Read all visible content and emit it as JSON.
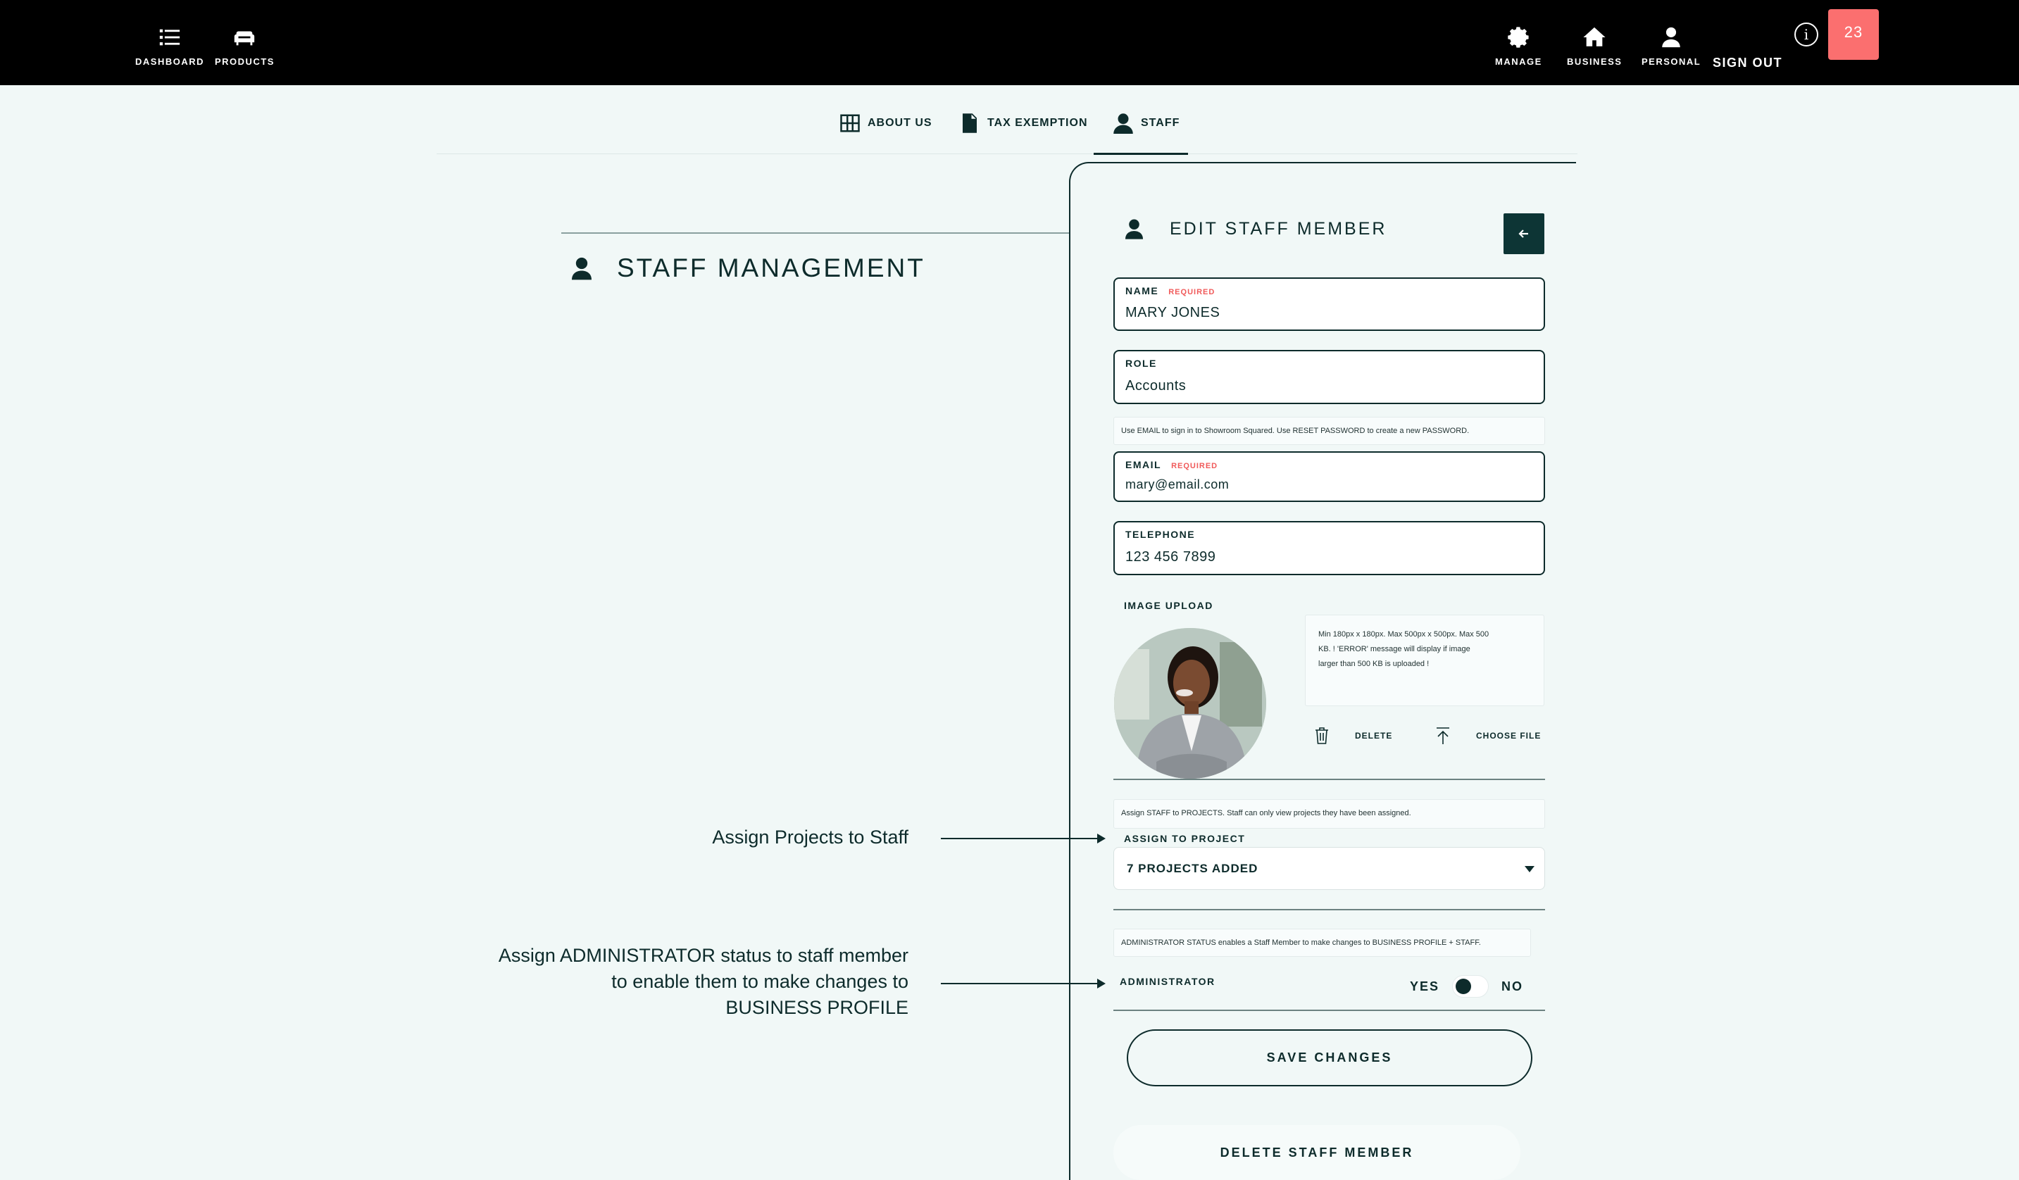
{
  "nav": {
    "dashboard": "DASHBOARD",
    "products": "PRODUCTS",
    "manage": "MANAGE",
    "business": "BUSINESS",
    "personal": "PERSONAL",
    "sign_out": "SIGN OUT",
    "info": "i",
    "badge_count": "23"
  },
  "tabs": [
    {
      "label": "ABOUT US",
      "icon": "group-icon"
    },
    {
      "label": "TAX EXEMPTION",
      "icon": "document-icon"
    },
    {
      "label": "STAFF",
      "icon": "person-icon",
      "active": true
    }
  ],
  "left": {
    "title": "STAFF MANAGEMENT",
    "annotation_projects": "Assign Projects to Staff",
    "annotation_admin_1": "Assign ADMINISTRATOR status to staff member",
    "annotation_admin_2": "to enable them to make changes to",
    "annotation_admin_3": "BUSINESS PROFILE"
  },
  "form": {
    "title": "EDIT STAFF MEMBER",
    "name_label": "NAME",
    "name_required": "REQUIRED",
    "name_value": "MARY JONES",
    "role_label": "ROLE",
    "role_value": "Accounts",
    "email_note": "Use EMAIL to sign in to Showroom Squared. Use RESET PASSWORD to create a new PASSWORD.",
    "email_label": "EMAIL",
    "email_required": "REQUIRED",
    "email_value": "mary@email.com",
    "telephone_label": "TELEPHONE",
    "telephone_value": "123 456 7899",
    "image_upload_label": "IMAGE UPLOAD",
    "image_hint_1": "Min 180px x 180px. Max 500px x 500px. Max 500",
    "image_hint_2": "KB.      ! 'ERROR' message will display if image",
    "image_hint_3": "larger than 500 KB is uploaded !",
    "delete_image": "DELETE",
    "choose_file": "CHOOSE FILE",
    "project_note": "Assign STAFF to PROJECTS. Staff can only view projects they have been assigned.",
    "assign_label": "ASSIGN TO PROJECT",
    "assign_value": "7 PROJECTS ADDED",
    "admin_note": "ADMINISTRATOR STATUS enables a Staff Member to make changes to BUSINESS PROFILE + STAFF.",
    "admin_label": "ADMINISTRATOR",
    "yes": "YES",
    "no": "NO",
    "save": "SAVE CHANGES",
    "delete_member": "DELETE STAFF MEMBER"
  },
  "colors": {
    "background": "#f1f8f7",
    "topbar": "#000000",
    "accent": "#0d2b2b",
    "badge": "#fb6f6f",
    "required": "#f05a5a"
  }
}
